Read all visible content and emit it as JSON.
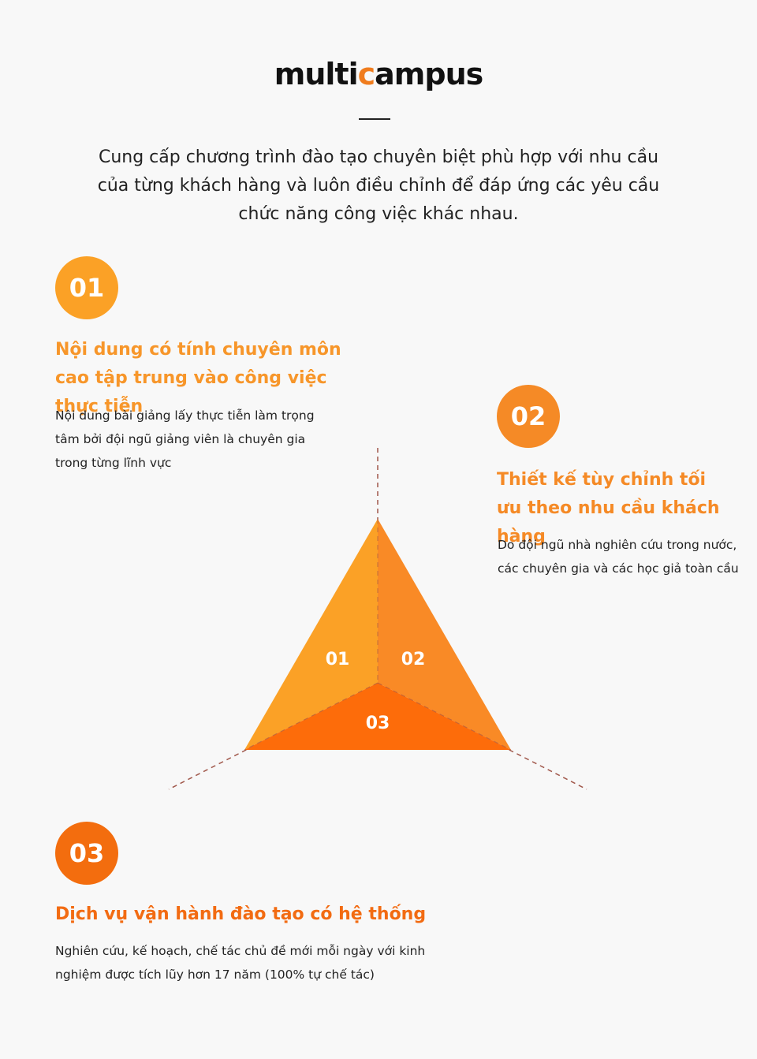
{
  "logo": {
    "before": "multi",
    "dot": "c",
    "after": "ampus"
  },
  "intro": "Cung cấp chương trình đào tạo chuyên biệt phù hợp với nhu cầu của từng khách hàng và luôn điều chỉnh để đáp ứng các yêu cầu chức năng công việc khác nhau.",
  "items": [
    {
      "number": "01",
      "title": "Nội dung có tính chuyên môn cao tập trung vào công việc thực tiễn",
      "description": "Nội dung bài giảng lấy thực tiễn làm trọng tâm bởi đội ngũ giảng viên là chuyên gia trong từng lĩnh vực",
      "color": "#fba126"
    },
    {
      "number": "02",
      "title": "Thiết kế tùy chỉnh tối ưu theo nhu cầu khách hàng",
      "description": "Do đội ngũ nhà nghiên cứu trong nước, các chuyên gia và các học giả toàn cầu",
      "color": "#f58a26"
    },
    {
      "number": "03",
      "title": "Dịch vụ vận hành đào tạo có hệ thống",
      "description": "Nghiên cứu, kế hoạch, chế tác chủ đề mới mỗi ngày với kinh nghiệm được tích lũy hơn 17 năm (100% tự chế tác)",
      "color": "#f36d0e"
    }
  ],
  "triangle": {
    "segments": [
      "01",
      "02",
      "03"
    ],
    "colors": [
      "#fba126",
      "#f98a26",
      "#fd6c0a"
    ],
    "line_color": "#a0574a"
  }
}
